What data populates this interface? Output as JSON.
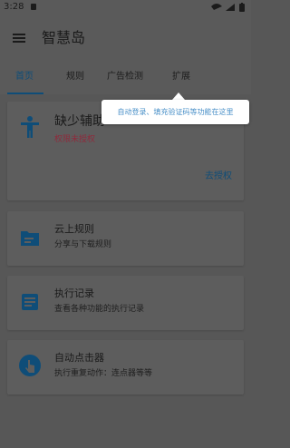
{
  "status_bar": {
    "time": "3:28"
  },
  "app_bar": {
    "title": "智慧岛"
  },
  "tabs": [
    {
      "label": "首页",
      "active": true
    },
    {
      "label": "规则",
      "active": false
    },
    {
      "label": "广告检测",
      "active": false
    },
    {
      "label": "扩展",
      "active": false
    }
  ],
  "tooltip": {
    "text": "自动登录、填充验证码等功能在这里"
  },
  "accessibility_card": {
    "title": "缺少辅助",
    "status": "权限未授权",
    "action": "去授权",
    "status_color": "#8f2a3c"
  },
  "cards": [
    {
      "title": "云上规则",
      "subtitle": "分享与下载规则",
      "icon": "folder-icon"
    },
    {
      "title": "执行记录",
      "subtitle": "查看各种功能的执行记录",
      "icon": "record-icon"
    },
    {
      "title": "自动点击器",
      "subtitle": "执行重复动作：连点器等等",
      "icon": "tap-icon"
    }
  ],
  "colors": {
    "accent": "#0f4d78",
    "overlay_background": "#575757",
    "tooltip_text": "#4a90c8"
  }
}
